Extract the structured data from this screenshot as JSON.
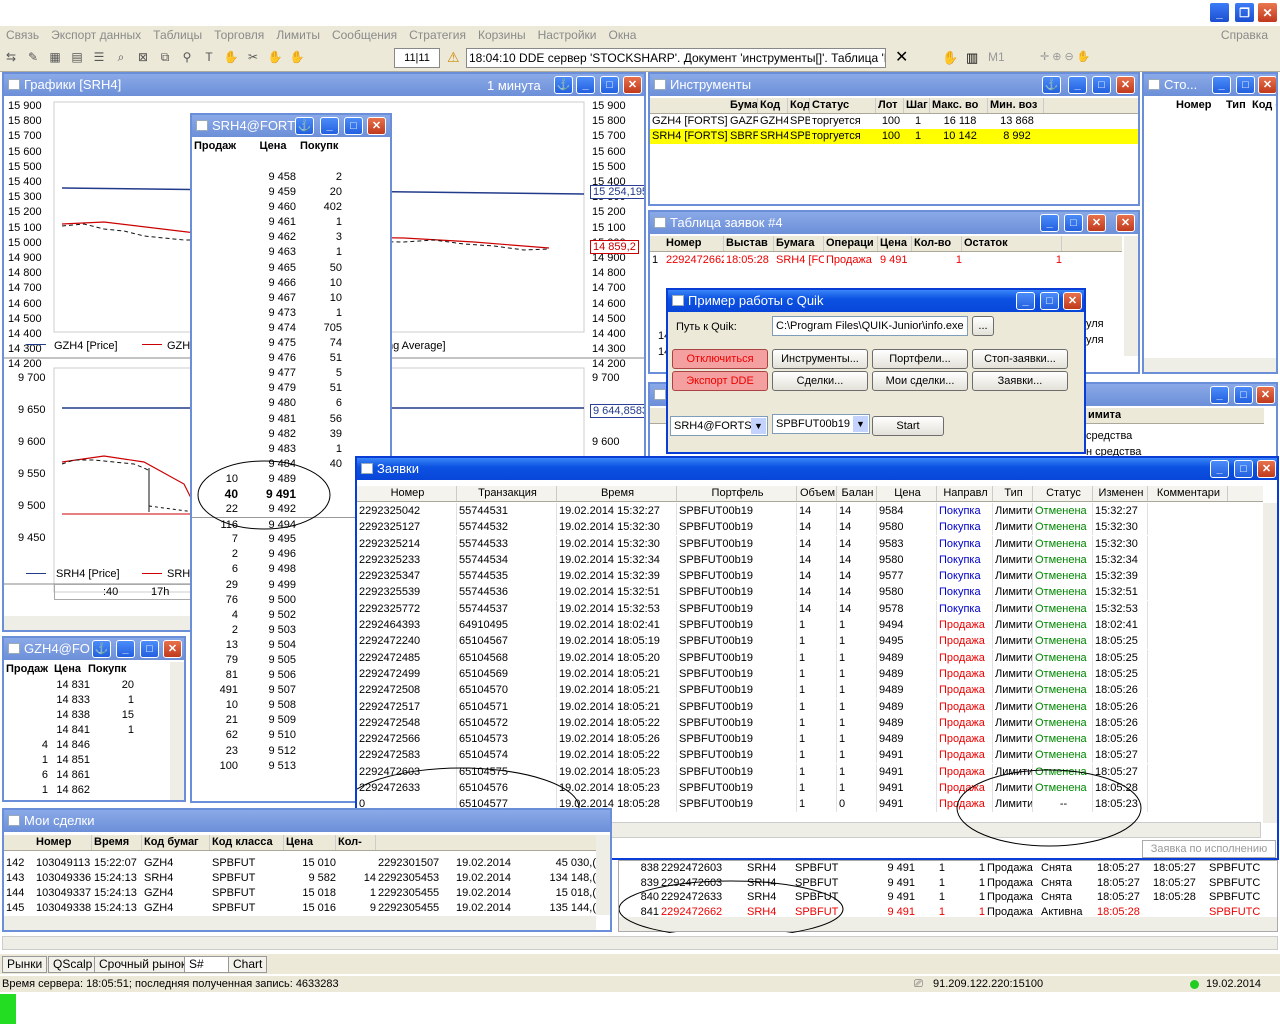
{
  "menu": [
    "Связь",
    "Экспорт данных",
    "Таблицы",
    "Торговля",
    "Лимиты",
    "Сообщения",
    "Стратегия",
    "Корзины",
    "Настройки",
    "Окна"
  ],
  "menu_help": "Справка",
  "toolbar": {
    "counter": "11|11",
    "message": "18:04:10  DDE сервер 'STOCKSHARP'. Документ 'инструменты[]'. Таблица 'Инс",
    "m1": "M1"
  },
  "charts": {
    "title": "Графики [SRH4]",
    "interval": "1 минута",
    "top_axis": [
      "15 900",
      "15 800",
      "15 700",
      "15 600",
      "15 500",
      "15 400",
      "15 300",
      "15 200",
      "15 100",
      "15 000",
      "14 900",
      "14 800",
      "14 700",
      "14 600",
      "14 500",
      "14 400",
      "14 300",
      "14 200"
    ],
    "top_marker1": "15 254,195",
    "top_marker2": "14 859,2",
    "legend1": [
      "GZH4 [Price]",
      "GZH",
      "ng Average]"
    ],
    "bot_axis_left": [
      "9 700",
      "9 650",
      "9 600",
      "9 550",
      "9 500",
      "9 450"
    ],
    "bot_axis_right": [
      "9 700",
      "9 600"
    ],
    "bot_marker": "9 644,8583",
    "legend2": [
      "SRH4 [Price]",
      "SRH"
    ],
    "time_labels": [
      ":40",
      "17h"
    ]
  },
  "dom1": {
    "title": "SRH4@FORTS",
    "headers": [
      "Продаж",
      "Цена",
      "Покупк"
    ],
    "rows": [
      [
        "",
        "9 458",
        "2"
      ],
      [
        "",
        "9 459",
        "20"
      ],
      [
        "",
        "9 460",
        "402"
      ],
      [
        "",
        "9 461",
        "1"
      ],
      [
        "",
        "9 462",
        "3"
      ],
      [
        "",
        "9 463",
        "1"
      ],
      [
        "",
        "9 465",
        "50"
      ],
      [
        "",
        "9 466",
        "10"
      ],
      [
        "",
        "9 467",
        "10"
      ],
      [
        "",
        "9 473",
        "1"
      ],
      [
        "",
        "9 474",
        "705"
      ],
      [
        "",
        "9 475",
        "74"
      ],
      [
        "",
        "9 476",
        "51"
      ],
      [
        "",
        "9 477",
        "5"
      ],
      [
        "",
        "9 479",
        "51"
      ],
      [
        "",
        "9 480",
        "6"
      ],
      [
        "",
        "9 481",
        "56"
      ],
      [
        "",
        "9 482",
        "39"
      ],
      [
        "",
        "9 483",
        "1"
      ],
      [
        "",
        "9 484",
        "40"
      ],
      [
        "10",
        "9 489",
        ""
      ],
      [
        "40",
        "9 491",
        ""
      ],
      [
        "22",
        "9 492",
        ""
      ],
      [
        "116",
        "9 494",
        ""
      ],
      [
        "7",
        "9 495",
        ""
      ],
      [
        "2",
        "9 496",
        ""
      ],
      [
        "6",
        "9 498",
        ""
      ],
      [
        "29",
        "9 499",
        ""
      ],
      [
        "76",
        "9 500",
        ""
      ],
      [
        "4",
        "9 502",
        ""
      ],
      [
        "2",
        "9 503",
        ""
      ],
      [
        "13",
        "9 504",
        ""
      ],
      [
        "79",
        "9 505",
        ""
      ],
      [
        "81",
        "9 506",
        ""
      ],
      [
        "491",
        "9 507",
        ""
      ],
      [
        "10",
        "9 508",
        ""
      ],
      [
        "21",
        "9 509",
        ""
      ],
      [
        "62",
        "9 510",
        ""
      ],
      [
        "23",
        "9 512",
        ""
      ],
      [
        "100",
        "9 513",
        ""
      ]
    ]
  },
  "dom2": {
    "title": "GZH4@FO",
    "headers": [
      "Продаж",
      "Цена",
      "Покупк"
    ],
    "rows": [
      [
        "",
        "14 831",
        "20"
      ],
      [
        "",
        "14 833",
        "1"
      ],
      [
        "",
        "14 838",
        "15"
      ],
      [
        "",
        "14 841",
        "1"
      ],
      [
        "4",
        "14 846",
        ""
      ],
      [
        "1",
        "14 851",
        ""
      ],
      [
        "6",
        "14 861",
        ""
      ],
      [
        "1",
        "14 862",
        ""
      ]
    ]
  },
  "instruments": {
    "title": "Инструменты",
    "headers": [
      "",
      "Бума",
      "Код",
      "Код",
      "Статус",
      "Лот",
      "Шаг",
      "Макс. во",
      "Мин. воз"
    ],
    "rows": [
      [
        "GZH4 [FORTS]",
        "GAZR-",
        "GZH4",
        "SPB",
        "торгуется",
        "100",
        "1",
        "16 118",
        "13 868"
      ],
      [
        "SRH4 [FORTS]",
        "SBRF-",
        "SRH4",
        "SPB",
        "торгуется",
        "100",
        "1",
        "10 142",
        "8 992"
      ]
    ]
  },
  "stop": {
    "title": "Сто...",
    "headers": [
      "Номер",
      "Тип",
      "Код с"
    ]
  },
  "orders4": {
    "title": "Таблица заявок #4",
    "headers": [
      "",
      "Номер",
      "Выстав",
      "Бумага",
      "Операци",
      "Цена",
      "Кол-во",
      "Остаток"
    ],
    "row": [
      "1",
      "2292472662",
      "18:05:28",
      "SRH4 [FORT",
      "Продажа",
      "9 491",
      "1",
      "1"
    ],
    "side_labels": [
      "14",
      "14"
    ],
    "side_right": [
      "уля",
      "уля"
    ]
  },
  "limits": {
    "label": "имита",
    "r1": "средства",
    "r2": "н средства"
  },
  "quik": {
    "title": "Пример работы с Quik",
    "path_label": "Путь к Quik:",
    "path": "C:\\Program Files\\QUIK-Junior\\info.exe",
    "browse": "...",
    "b_disconnect": "Отключиться",
    "b_instruments": "Инструменты...",
    "b_portfolios": "Портфели...",
    "b_stop": "Стоп-заявки...",
    "b_export": "Экспорт DDE",
    "b_trades": "Сделки...",
    "b_mytrades": "Мои сделки...",
    "b_orders": "Заявки...",
    "sel1": "SRH4@FORTS",
    "sel2": "SPBFUT00b19",
    "start": "Start"
  },
  "orders": {
    "title": "Заявки",
    "headers": [
      "Номер",
      "Транзакция",
      "Время",
      "Портфель",
      "Объем",
      "Балан",
      "Цена",
      "Направл",
      "Тип",
      "Статус",
      "Изменен",
      "Комментари"
    ],
    "rows": [
      [
        "2292325042",
        "55744531",
        "19.02.2014 15:32:27",
        "SPBFUT00b19",
        "14",
        "14",
        "9584",
        "Покупка",
        "Лимити",
        "Отменена",
        "15:32:27"
      ],
      [
        "2292325127",
        "55744532",
        "19.02.2014 15:32:30",
        "SPBFUT00b19",
        "14",
        "14",
        "9580",
        "Покупка",
        "Лимити",
        "Отменена",
        "15:32:30"
      ],
      [
        "2292325214",
        "55744533",
        "19.02.2014 15:32:30",
        "SPBFUT00b19",
        "14",
        "14",
        "9583",
        "Покупка",
        "Лимити",
        "Отменена",
        "15:32:30"
      ],
      [
        "2292325233",
        "55744534",
        "19.02.2014 15:32:34",
        "SPBFUT00b19",
        "14",
        "14",
        "9580",
        "Покупка",
        "Лимити",
        "Отменена",
        "15:32:34"
      ],
      [
        "2292325347",
        "55744535",
        "19.02.2014 15:32:39",
        "SPBFUT00b19",
        "14",
        "14",
        "9577",
        "Покупка",
        "Лимити",
        "Отменена",
        "15:32:39"
      ],
      [
        "2292325539",
        "55744536",
        "19.02.2014 15:32:51",
        "SPBFUT00b19",
        "14",
        "14",
        "9580",
        "Покупка",
        "Лимити",
        "Отменена",
        "15:32:51"
      ],
      [
        "2292325772",
        "55744537",
        "19.02.2014 15:32:53",
        "SPBFUT00b19",
        "14",
        "14",
        "9578",
        "Покупка",
        "Лимити",
        "Отменена",
        "15:32:53"
      ],
      [
        "2292464393",
        "64910495",
        "19.02.2014 18:02:41",
        "SPBFUT00b19",
        "1",
        "1",
        "9494",
        "Продажа",
        "Лимити",
        "Отменена",
        "18:02:41"
      ],
      [
        "2292472240",
        "65104567",
        "19.02.2014 18:05:19",
        "SPBFUT00b19",
        "1",
        "1",
        "9495",
        "Продажа",
        "Лимити",
        "Отменена",
        "18:05:25"
      ],
      [
        "2292472485",
        "65104568",
        "19.02.2014 18:05:20",
        "SPBFUT00b19",
        "1",
        "1",
        "9489",
        "Продажа",
        "Лимити",
        "Отменена",
        "18:05:25"
      ],
      [
        "2292472499",
        "65104569",
        "19.02.2014 18:05:21",
        "SPBFUT00b19",
        "1",
        "1",
        "9489",
        "Продажа",
        "Лимити",
        "Отменена",
        "18:05:25"
      ],
      [
        "2292472508",
        "65104570",
        "19.02.2014 18:05:21",
        "SPBFUT00b19",
        "1",
        "1",
        "9489",
        "Продажа",
        "Лимити",
        "Отменена",
        "18:05:26"
      ],
      [
        "2292472517",
        "65104571",
        "19.02.2014 18:05:21",
        "SPBFUT00b19",
        "1",
        "1",
        "9489",
        "Продажа",
        "Лимити",
        "Отменена",
        "18:05:26"
      ],
      [
        "2292472548",
        "65104572",
        "19.02.2014 18:05:22",
        "SPBFUT00b19",
        "1",
        "1",
        "9489",
        "Продажа",
        "Лимити",
        "Отменена",
        "18:05:26"
      ],
      [
        "2292472566",
        "65104573",
        "19.02.2014 18:05:26",
        "SPBFUT00b19",
        "1",
        "1",
        "9489",
        "Продажа",
        "Лимити",
        "Отменена",
        "18:05:26"
      ],
      [
        "2292472583",
        "65104574",
        "19.02.2014 18:05:22",
        "SPBFUT00b19",
        "1",
        "1",
        "9491",
        "Продажа",
        "Лимити",
        "Отменена",
        "18:05:27"
      ],
      [
        "2292472603",
        "65104575",
        "19.02.2014 18:05:23",
        "SPBFUT00b19",
        "1",
        "1",
        "9491",
        "Продажа",
        "Лимити",
        "Отменена",
        "18:05:27"
      ],
      [
        "2292472633",
        "65104576",
        "19.02.2014 18:05:23",
        "SPBFUT00b19",
        "1",
        "1",
        "9491",
        "Продажа",
        "Лимити",
        "Отменена",
        "18:05:28"
      ],
      [
        "0",
        "65104577",
        "19.02.2014 18:05:28",
        "SPBFUT00b19",
        "1",
        "0",
        "9491",
        "Продажа",
        "Лимити",
        "--",
        "18:05:23"
      ]
    ],
    "bottom_btn": "Заявка по исполнению"
  },
  "mytrades": {
    "title": "Мои сделки",
    "headers": [
      "",
      "Номер",
      "Время",
      "Код бумаг",
      "Код класса",
      "Цена",
      "Кол-"
    ],
    "rows": [
      [
        "142",
        "103049113",
        "15:22:07",
        "GZH4",
        "SPBFUT",
        "15 010",
        "",
        "2292301507",
        "19.02.2014",
        "45 030,("
      ],
      [
        "143",
        "103049336",
        "15:24:13",
        "SRH4",
        "SPBFUT",
        "9 582",
        "14",
        "2292305453",
        "19.02.2014",
        "134 148,("
      ],
      [
        "144",
        "103049337",
        "15:24:13",
        "GZH4",
        "SPBFUT",
        "15 018",
        "1",
        "2292305455",
        "19.02.2014",
        "15 018,("
      ],
      [
        "145",
        "103049338",
        "15:24:13",
        "GZH4",
        "SPBFUT",
        "15 016",
        "9",
        "2292305455",
        "19.02.2014",
        "135 144,("
      ]
    ]
  },
  "trades2": {
    "rows": [
      [
        "838",
        "2292472603",
        "SRH4",
        "SPBFUT",
        "9 491",
        "1",
        "1",
        "Продажа",
        "Снята",
        "18:05:27",
        "18:05:27",
        "SPBFUTC"
      ],
      [
        "839",
        "2292472603",
        "SRH4",
        "SPBFUT",
        "9 491",
        "1",
        "1",
        "Продажа",
        "Снята",
        "18:05:27",
        "18:05:27",
        "SPBFUTC"
      ],
      [
        "840",
        "2292472633",
        "SRH4",
        "SPBFUT",
        "9 491",
        "1",
        "1",
        "Продажа",
        "Снята",
        "18:05:27",
        "18:05:28",
        "SPBFUTC"
      ],
      [
        "841",
        "2292472662",
        "SRH4",
        "SPBFUT",
        "9 491",
        "1",
        "1",
        "Продажа",
        "Активна",
        "18:05:28",
        "",
        "SPBFUTC"
      ]
    ]
  },
  "tabs": [
    "Рынки",
    "QScalp",
    "Срочный рынок",
    "S#",
    "Chart"
  ],
  "status": {
    "left": "Время сервера: 18:05:51; последняя полученная запись: 4633283",
    "ip": "91.209.122.220:15100",
    "date": "19.02.2014"
  }
}
